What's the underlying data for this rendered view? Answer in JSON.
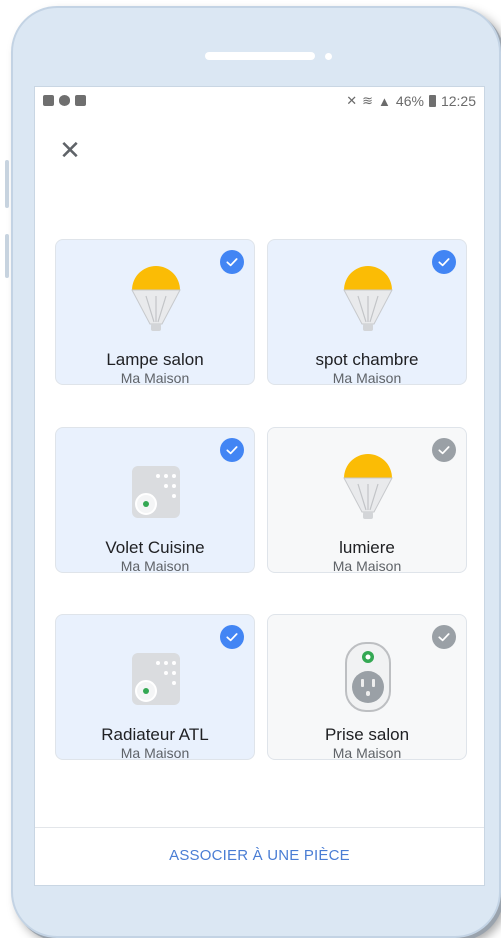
{
  "status_bar": {
    "left_icons": [
      "image-icon",
      "sd-card-icon",
      "mail-icon"
    ],
    "right_icons": [
      "mute-icon",
      "wifi-icon",
      "signal-icon"
    ],
    "battery": "46%",
    "time": "12:25"
  },
  "close_icon_glyph": "✕",
  "colors": {
    "accent_blue": "#4285f4",
    "selected_tile": "#e9f1fd",
    "unselected_tile": "#f7f8f9",
    "bulb_yellow": "#fbbc05",
    "link_blue": "#4a7dd4"
  },
  "devices": [
    {
      "name": "Lampe salon",
      "home": "Ma Maison",
      "icon": "light-bulb-icon",
      "selected": true
    },
    {
      "name": "spot chambre",
      "home": "Ma Maison",
      "icon": "light-bulb-icon",
      "selected": true
    },
    {
      "name": "Volet Cuisine",
      "home": "Ma Maison",
      "icon": "shutter-remote-icon",
      "selected": true
    },
    {
      "name": "lumiere",
      "home": "Ma Maison",
      "icon": "light-bulb-icon",
      "selected": false
    },
    {
      "name": "Radiateur ATL",
      "home": "Ma Maison",
      "icon": "shutter-remote-icon",
      "selected": true
    },
    {
      "name": "Prise salon",
      "home": "Ma Maison",
      "icon": "smart-plug-icon",
      "selected": false
    }
  ],
  "action": {
    "label": "ASSOCIER À UNE PIÈCE"
  }
}
